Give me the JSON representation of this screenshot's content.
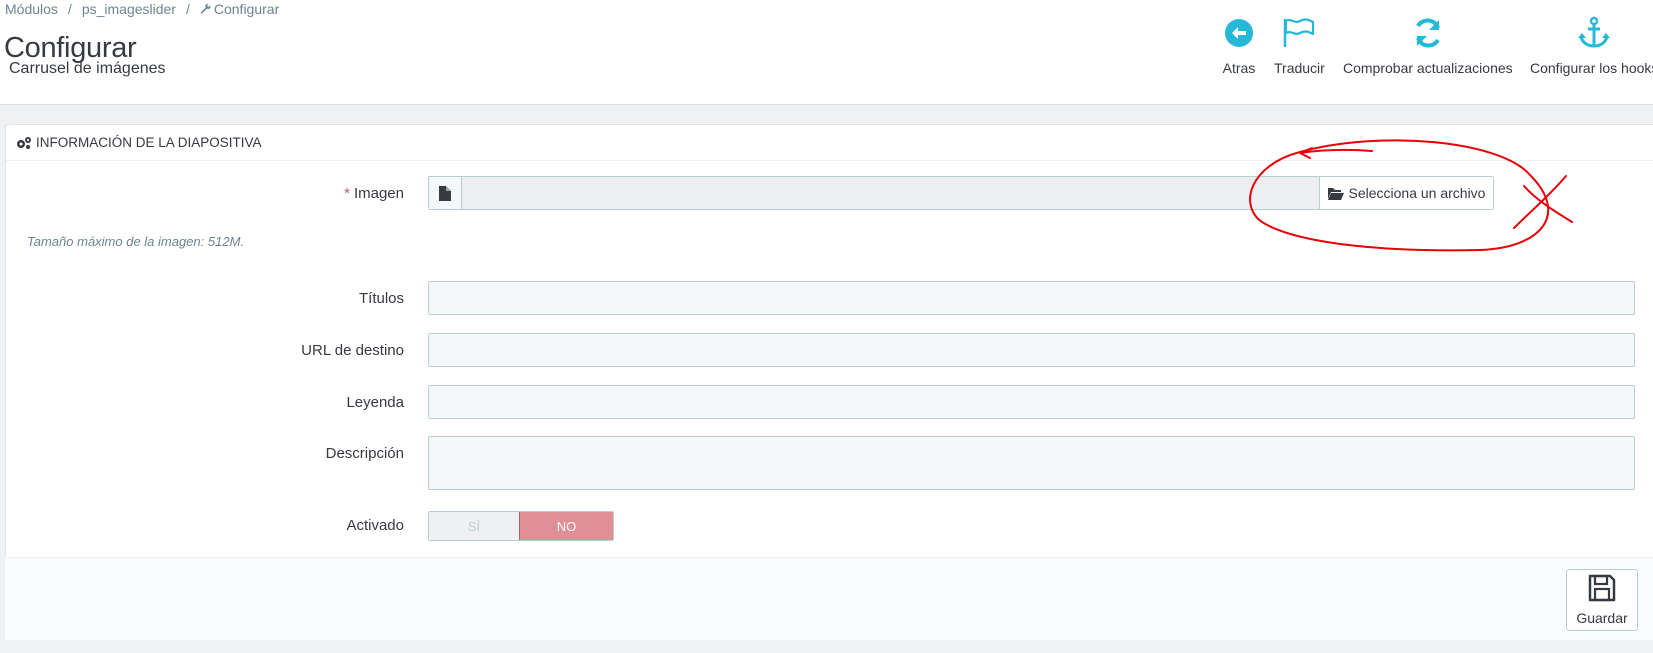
{
  "breadcrumb": {
    "items": [
      "Módulos",
      "ps_imageslider",
      "Configurar"
    ],
    "separator": "/"
  },
  "page": {
    "title": "Configurar",
    "subtitle": "Carrusel de imágenes"
  },
  "toolbar": {
    "back_label": "Atras",
    "translate_label": "Traducir",
    "check_updates_label": "Comprobar actualizaciones",
    "configure_hooks_label": "Configurar los hooks"
  },
  "panel": {
    "heading": "Información de la diapositiva"
  },
  "form": {
    "image_required_mark": "*",
    "image_label": "Imagen",
    "file_button_label": "Selecciona un archivo",
    "image_help": "Tamaño máximo de la imagen: 512M.",
    "titles_label": "Títulos",
    "url_label": "URL de destino",
    "legend_label": "Leyenda",
    "description_label": "Descripción",
    "enabled_label": "Activado",
    "switch_yes": "SÍ",
    "switch_no": "NO",
    "enabled_value": "NO"
  },
  "footer": {
    "save_label": "Guardar"
  },
  "colors": {
    "accent": "#25b9d7",
    "danger": "#e08f95",
    "annotation": "#e8000b"
  },
  "icons": {
    "back": "arrow-circle-left-icon",
    "translate": "flag-icon",
    "refresh": "refresh-icon",
    "anchor": "anchor-icon",
    "gears": "gears-icon",
    "file": "file-icon",
    "folder": "folder-open-icon",
    "save": "floppy-disk-icon",
    "wrench": "wrench-icon"
  }
}
